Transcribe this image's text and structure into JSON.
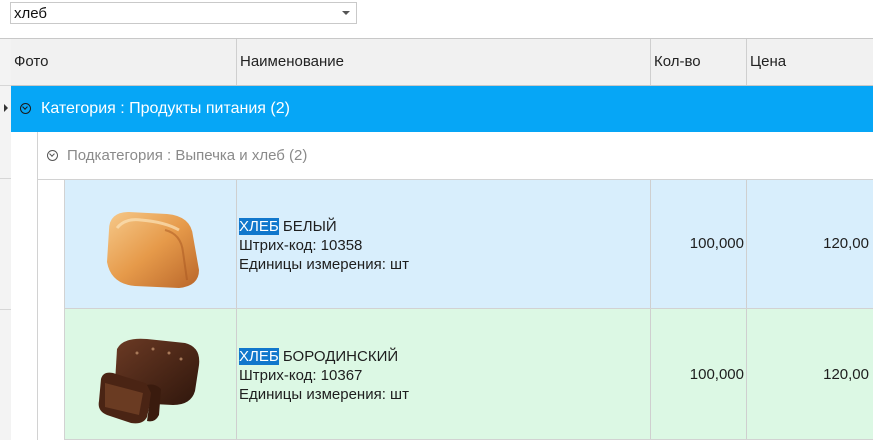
{
  "search": {
    "value": "хлеб"
  },
  "grid": {
    "columns": [
      {
        "key": "photo",
        "label": "Фото"
      },
      {
        "key": "name",
        "label": "Наименование"
      },
      {
        "key": "qty",
        "label": "Кол-во"
      },
      {
        "key": "price",
        "label": "Цена"
      }
    ],
    "group_level1": {
      "label": "Категория : Продукты питания (2)"
    },
    "group_level2": {
      "label": "Подкатегория : Выпечка и хлеб (2)"
    },
    "rows": [
      {
        "highlight": "ХЛЕБ",
        "name_rest": " БЕЛЫЙ",
        "barcode": "Штрих-код: 10358",
        "unit": "Единицы измерения: шт",
        "qty": "100,000",
        "price": "120,00",
        "photo_icon": "white-bread-icon",
        "row_color": "#d8eefc"
      },
      {
        "highlight": "ХЛЕБ",
        "name_rest": " БОРОДИНСКИЙ",
        "barcode": "Штрих-код: 10367",
        "unit": "Единицы измерения: шт",
        "qty": "100,000",
        "price": "120,00",
        "photo_icon": "rye-bread-icon",
        "row_color": "#dcf8e4"
      }
    ]
  },
  "colors": {
    "group_header": "#06a6f6",
    "search_highlight": "#1177cc"
  }
}
